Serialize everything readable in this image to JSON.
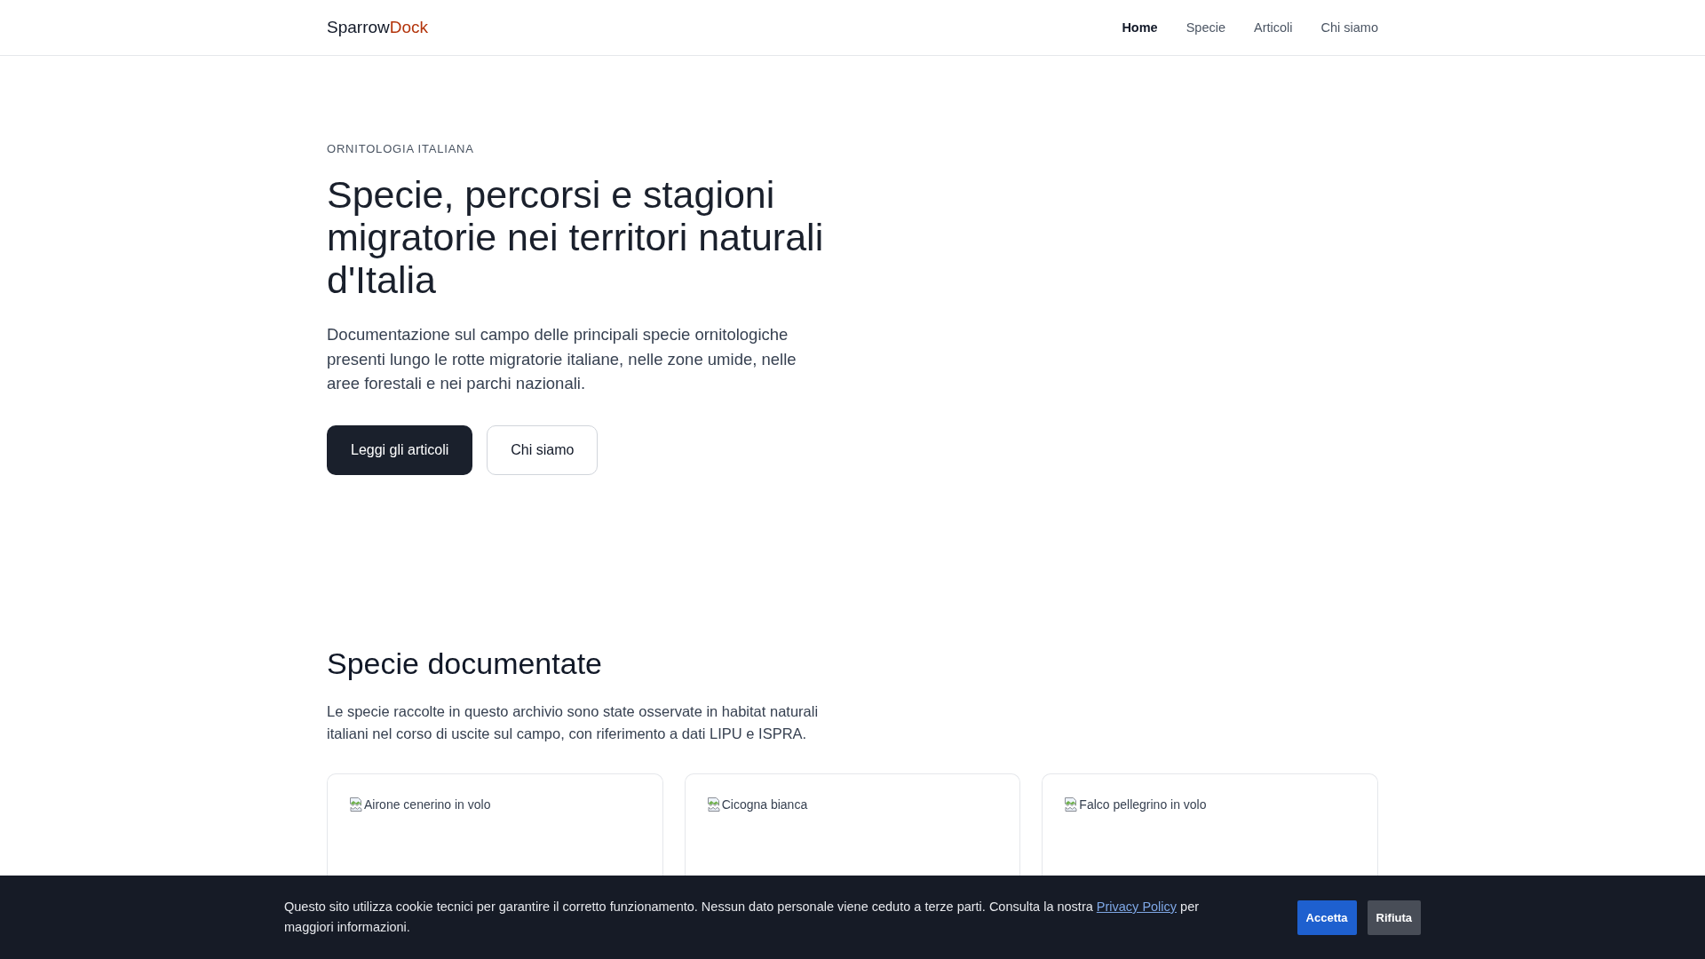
{
  "header": {
    "logo": {
      "text": "Sparrow",
      "accent": "Dock"
    },
    "nav": [
      {
        "label": "Home",
        "selected": true
      },
      {
        "label": "Specie",
        "selected": false
      },
      {
        "label": "Articoli",
        "selected": false
      },
      {
        "label": "Chi siamo",
        "selected": false
      }
    ]
  },
  "hero": {
    "eyebrow": "ORNITOLOGIA ITALIANA",
    "title": "Specie, percorsi e stagioni migratorie nei territori naturali d'Italia",
    "description": "Documentazione sul campo delle principali specie ornitologiche presenti lungo le rotte migratorie italiane, nelle zone umide, nelle aree forestali e nei parchi nazionali.",
    "buttons": [
      {
        "label": "Leggi gli articoli",
        "kind": "primary"
      },
      {
        "label": "Chi siamo",
        "kind": "secondary"
      }
    ]
  },
  "species": {
    "title": "Specie documentate",
    "description": "Le specie raccolte in questo archivio sono state osservate in habitat naturali italiani nel corso di uscite sul campo, con riferimento a dati LIPU e ISPRA.",
    "cards": [
      {
        "image_alt": "Airone cenerino in volo"
      },
      {
        "image_alt": "Cicogna bianca"
      },
      {
        "image_alt": "Falco pellegrino in volo"
      }
    ]
  },
  "cookie_banner": {
    "text": "Questo sito utilizza cookie tecnici per garantire il corretto funzionamento. Nessun dato personale viene ceduto a terze parti. Consulta la nostra",
    "link": "Privacy Policy",
    "text_end": "per maggiori informazioni.",
    "buttons": [
      {
        "label": "Accetta",
        "kind": "accept"
      },
      {
        "label": "Rifiuta",
        "kind": "reject"
      }
    ]
  }
}
